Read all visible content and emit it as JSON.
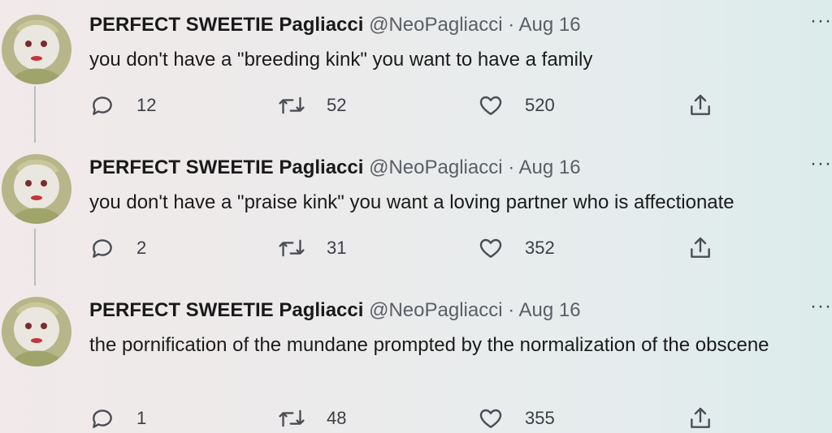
{
  "tweets": [
    {
      "name": "PERFECT SWEETIE Pagliacci",
      "handle": "@NeoPagliacci",
      "date": "Aug 16",
      "text": "you don't have a \"breeding kink\" you want to have a family",
      "replies": "12",
      "retweets": "52",
      "likes": "520"
    },
    {
      "name": "PERFECT SWEETIE Pagliacci",
      "handle": "@NeoPagliacci",
      "date": "Aug 16",
      "text": "you don't have a \"praise kink\" you want a loving partner who is affectionate",
      "replies": "2",
      "retweets": "31",
      "likes": "352"
    },
    {
      "name": "PERFECT SWEETIE Pagliacci",
      "handle": "@NeoPagliacci",
      "date": "Aug 16",
      "text": "the pornification of the mundane prompted by the normalization of the obscene",
      "replies": "1",
      "retweets": "48",
      "likes": "355"
    }
  ],
  "ui": {
    "separator": "·",
    "more_glyph": "···"
  },
  "icons": {
    "reply": "reply-icon",
    "retweet": "retweet-icon",
    "like": "heart-icon",
    "share": "share-icon",
    "more": "more-icon"
  },
  "colors": {
    "text": "#1b1b1b",
    "muted": "#5a5f66",
    "icon": "#4a4e55",
    "thread_line": "#b9bcc0"
  }
}
